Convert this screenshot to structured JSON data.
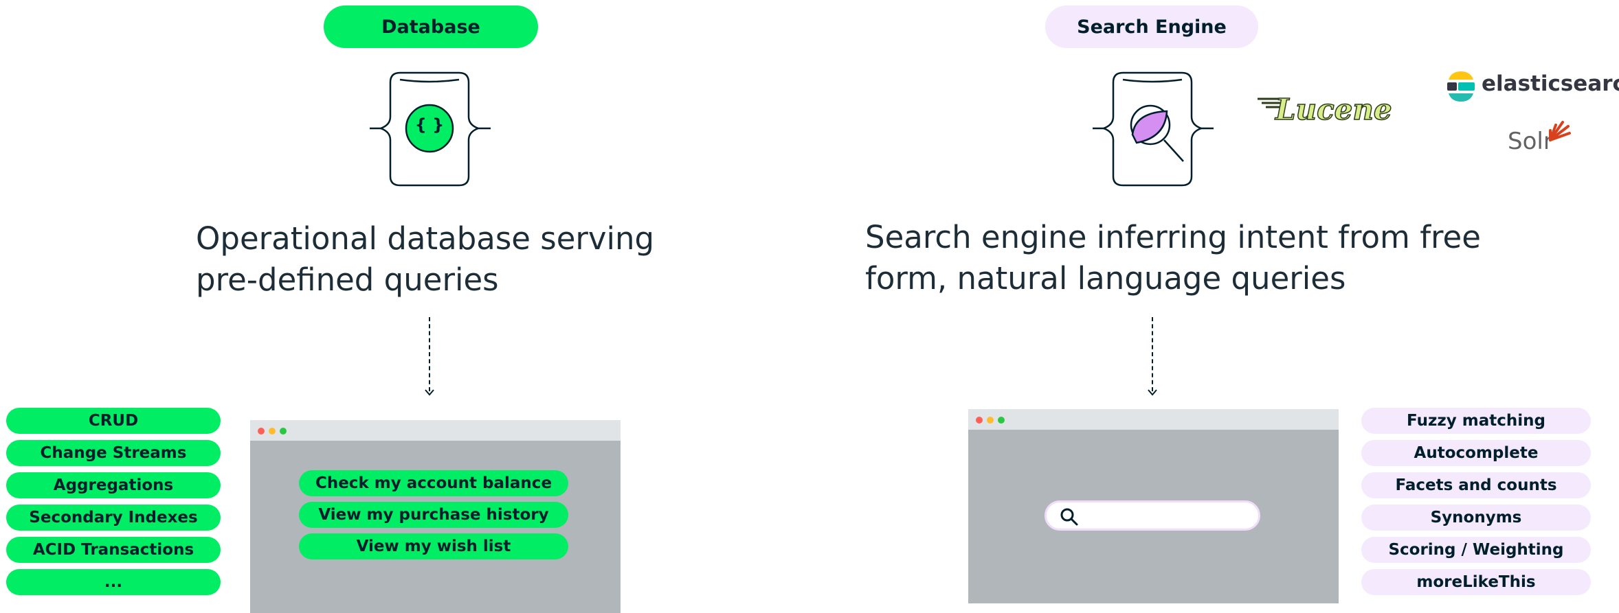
{
  "database": {
    "header": "Database",
    "description_line1": "Operational database serving",
    "description_line2": "pre-defined queries",
    "features": [
      "CRUD",
      "Change Streams",
      "Aggregations",
      "Secondary Indexes",
      "ACID Transactions",
      "..."
    ],
    "queries": [
      "Check my account balance",
      "View my purchase history",
      "View my wish list"
    ],
    "icon_glyph": "{ }"
  },
  "search_engine": {
    "header": "Search Engine",
    "description_line1": "Search engine inferring intent from free",
    "description_line2": "form, natural language queries",
    "features": [
      "Fuzzy matching",
      "Autocomplete",
      "Facets and counts",
      "Synonyms",
      "Scoring / Weighting",
      "moreLikeThis"
    ],
    "logos": {
      "lucene": "Lucene",
      "elasticsearch": "elasticsearch",
      "solr": "Solr"
    }
  },
  "colors": {
    "green_accent": "#00ed64",
    "lilac_accent": "#f4e9fd",
    "magnifier_fill": "#d58ef2",
    "window_body": "#b1b6bb",
    "window_bar": "#e1e4e6",
    "dark": "#001e2b"
  },
  "icons": [
    "database-doc-icon",
    "search-doc-icon",
    "search-icon",
    "lucene-logo",
    "elasticsearch-logo",
    "solr-logo"
  ]
}
